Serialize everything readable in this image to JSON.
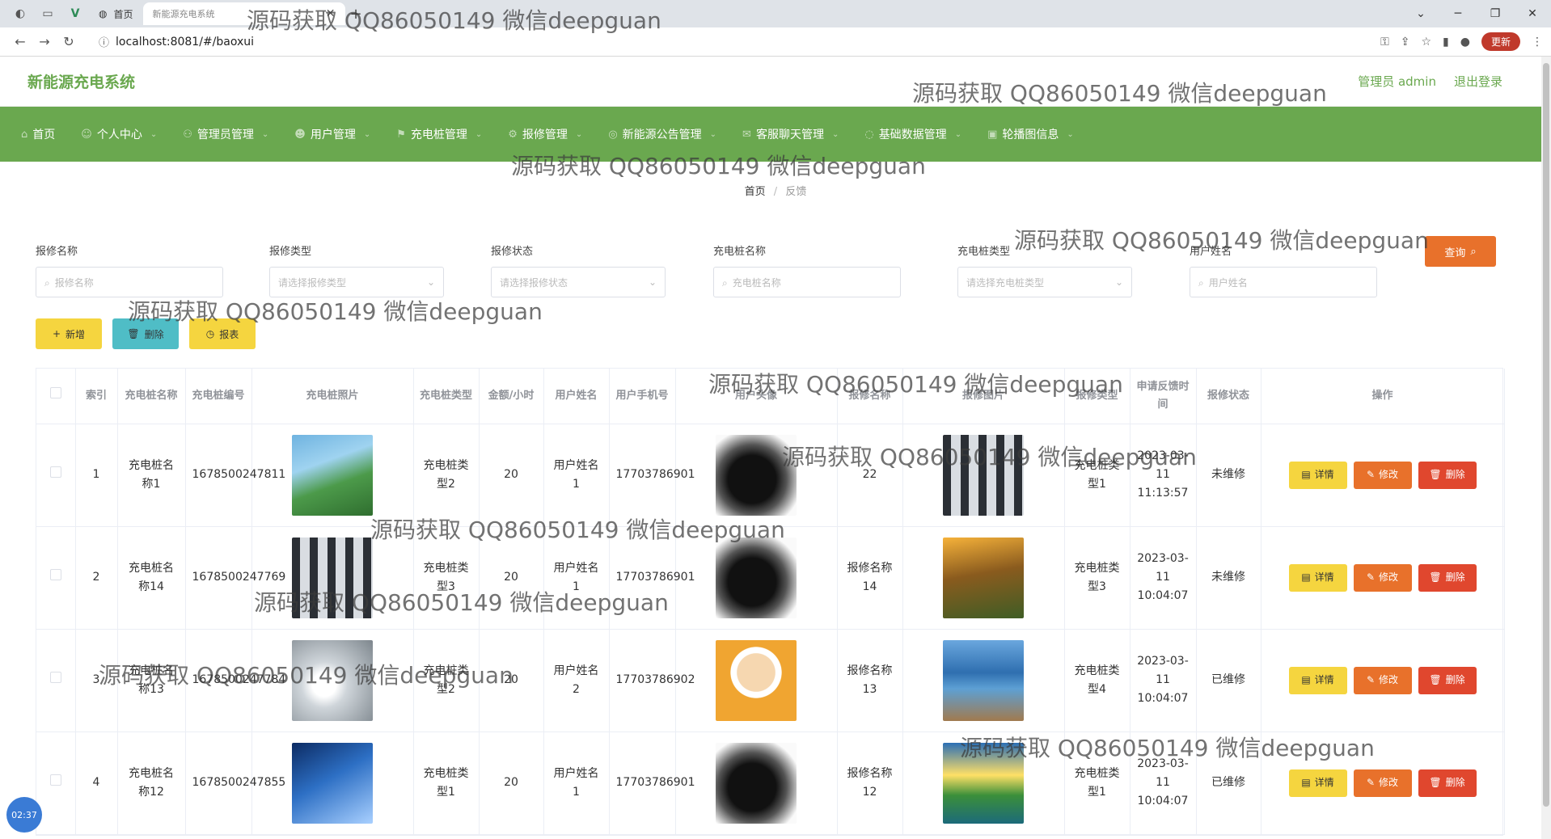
{
  "browser": {
    "tabs": [
      {
        "label": "首页",
        "active": false
      },
      {
        "label": "新能源充电系统",
        "active": true
      }
    ],
    "url": "localhost:8081/#/baoxui",
    "update_label": "更新"
  },
  "app": {
    "title": "新能源充电系统",
    "user_label": "管理员 admin",
    "logout_label": "退出登录"
  },
  "nav": [
    {
      "label": "首页",
      "has_caret": false
    },
    {
      "label": "个人中心",
      "has_caret": true
    },
    {
      "label": "管理员管理",
      "has_caret": true
    },
    {
      "label": "用户管理",
      "has_caret": true
    },
    {
      "label": "充电桩管理",
      "has_caret": true
    },
    {
      "label": "报修管理",
      "has_caret": true
    },
    {
      "label": "新能源公告管理",
      "has_caret": true
    },
    {
      "label": "客服聊天管理",
      "has_caret": true
    },
    {
      "label": "基础数据管理",
      "has_caret": true
    },
    {
      "label": "轮播图信息",
      "has_caret": true
    }
  ],
  "breadcrumb": {
    "home": "首页",
    "separator": "/",
    "current": "反馈"
  },
  "search": {
    "fields": [
      {
        "label": "报修名称",
        "placeholder": "报修名称",
        "type": "input"
      },
      {
        "label": "报修类型",
        "placeholder": "请选择报修类型",
        "type": "select"
      },
      {
        "label": "报修状态",
        "placeholder": "请选择报修状态",
        "type": "select"
      },
      {
        "label": "充电桩名称",
        "placeholder": "充电桩名称",
        "type": "input"
      },
      {
        "label": "充电桩类型",
        "placeholder": "请选择充电桩类型",
        "type": "select"
      },
      {
        "label": "用户姓名",
        "placeholder": "用户姓名",
        "type": "input"
      }
    ],
    "query_label": "查询"
  },
  "actions": {
    "add": "新增",
    "delete": "删除",
    "report": "报表"
  },
  "table": {
    "headers": [
      "",
      "索引",
      "充电桩名称",
      "充电桩编号",
      "充电桩照片",
      "充电桩类型",
      "金额/小时",
      "用户姓名",
      "用户手机号",
      "用户头像",
      "报修名称",
      "报修图片",
      "报修类型",
      "申请反馈时间",
      "报修状态",
      "操作"
    ],
    "op_labels": {
      "detail": "详情",
      "edit": "修改",
      "remove": "删除"
    },
    "rows": [
      {
        "index": "1",
        "pile_name": "充电桩名称1",
        "pile_no": "1678500247811",
        "pile_photo": "station-green",
        "pile_type": "充电桩类型2",
        "price": "20",
        "user_name": "用户姓名1",
        "phone": "17703786901",
        "avatar": "man",
        "repair_name": "22",
        "repair_img": "station-row",
        "repair_type": "充电桩类型1",
        "time": "2023-03-11 11:13:57",
        "status": "未维修"
      },
      {
        "index": "2",
        "pile_name": "充电桩名称14",
        "pile_no": "1678500247769",
        "pile_photo": "station-row",
        "pile_type": "充电桩类型3",
        "price": "20",
        "user_name": "用户姓名1",
        "phone": "17703786901",
        "avatar": "man",
        "repair_name": "报修名称14",
        "repair_img": "sunset",
        "repair_type": "充电桩类型3",
        "time": "2023-03-11 10:04:07",
        "status": "未维修"
      },
      {
        "index": "3",
        "pile_name": "充电桩名称13",
        "pile_no": "1678500247784",
        "pile_photo": "plug",
        "pile_type": "充电桩类型2",
        "price": "20",
        "user_name": "用户姓名2",
        "phone": "17703786902",
        "avatar": "cartoon",
        "repair_name": "报修名称13",
        "repair_img": "lake",
        "repair_type": "充电桩类型4",
        "time": "2023-03-11 10:04:07",
        "status": "已维修"
      },
      {
        "index": "4",
        "pile_name": "充电桩名称12",
        "pile_no": "1678500247855",
        "pile_photo": "blue-station",
        "pile_type": "充电桩类型1",
        "price": "20",
        "user_name": "用户姓名1",
        "phone": "17703786901",
        "avatar": "man",
        "repair_name": "报修名称12",
        "repair_img": "green-lake",
        "repair_type": "充电桩类型1",
        "time": "2023-03-11 10:04:07",
        "status": "已维修"
      }
    ]
  },
  "clock": "02:37",
  "watermark_text": "源码获取 QQ86050149 微信deepguan"
}
